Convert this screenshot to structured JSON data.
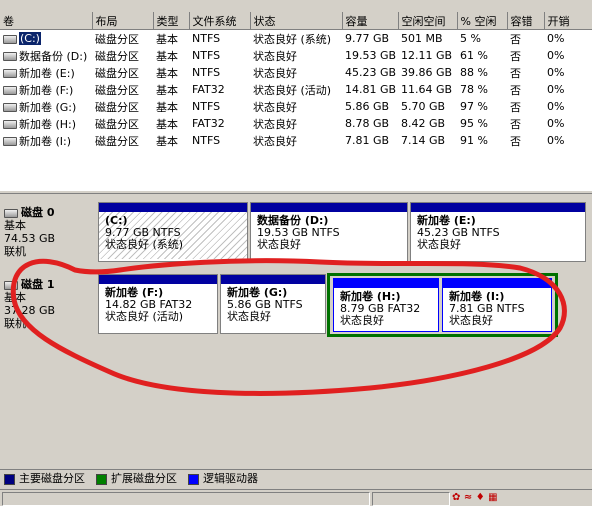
{
  "table": {
    "columns": [
      "卷",
      "布局",
      "类型",
      "文件系统",
      "状态",
      "容量",
      "空闲空间",
      "% 空闲",
      "容错",
      "开销"
    ],
    "rows": [
      {
        "vol": "(C:)",
        "layout": "磁盘分区",
        "type": "基本",
        "fs": "NTFS",
        "status": "状态良好 (系统)",
        "capacity": "9.77 GB",
        "free": "501 MB",
        "pct": "5 %",
        "fault": "否",
        "overhead": "0%"
      },
      {
        "vol": "数据备份 (D:)",
        "layout": "磁盘分区",
        "type": "基本",
        "fs": "NTFS",
        "status": "状态良好",
        "capacity": "19.53 GB",
        "free": "12.11 GB",
        "pct": "61 %",
        "fault": "否",
        "overhead": "0%"
      },
      {
        "vol": "新加卷 (E:)",
        "layout": "磁盘分区",
        "type": "基本",
        "fs": "NTFS",
        "status": "状态良好",
        "capacity": "45.23 GB",
        "free": "39.86 GB",
        "pct": "88 %",
        "fault": "否",
        "overhead": "0%"
      },
      {
        "vol": "新加卷 (F:)",
        "layout": "磁盘分区",
        "type": "基本",
        "fs": "FAT32",
        "status": "状态良好 (活动)",
        "capacity": "14.81 GB",
        "free": "11.64 GB",
        "pct": "78 %",
        "fault": "否",
        "overhead": "0%"
      },
      {
        "vol": "新加卷 (G:)",
        "layout": "磁盘分区",
        "type": "基本",
        "fs": "NTFS",
        "status": "状态良好",
        "capacity": "5.86 GB",
        "free": "5.70 GB",
        "pct": "97 %",
        "fault": "否",
        "overhead": "0%"
      },
      {
        "vol": "新加卷 (H:)",
        "layout": "磁盘分区",
        "type": "基本",
        "fs": "FAT32",
        "status": "状态良好",
        "capacity": "8.78 GB",
        "free": "8.42 GB",
        "pct": "95 %",
        "fault": "否",
        "overhead": "0%"
      },
      {
        "vol": "新加卷 (I:)",
        "layout": "磁盘分区",
        "type": "基本",
        "fs": "NTFS",
        "status": "状态良好",
        "capacity": "7.81 GB",
        "free": "7.14 GB",
        "pct": "91 %",
        "fault": "否",
        "overhead": "0%"
      }
    ]
  },
  "disks": [
    {
      "name": "磁盘 0",
      "type": "基本",
      "size": "74.53 GB",
      "state": "联机",
      "partitions": [
        {
          "name": "(C:)",
          "info": "9.77 GB NTFS",
          "status": "状态良好 (系统)"
        },
        {
          "name": "数据备份  (D:)",
          "info": "19.53 GB NTFS",
          "status": "状态良好"
        },
        {
          "name": "新加卷  (E:)",
          "info": "45.23 GB NTFS",
          "status": "状态良好"
        }
      ]
    },
    {
      "name": "磁盘 1",
      "type": "基本",
      "size": "37.28 GB",
      "state": "联机",
      "partitions": [
        {
          "name": "新加卷  (F:)",
          "info": "14.82 GB FAT32",
          "status": "状态良好 (活动)"
        },
        {
          "name": "新加卷  (G:)",
          "info": "5.86 GB NTFS",
          "status": "状态良好"
        },
        {
          "name": "新加卷  (H:)",
          "info": "8.79 GB FAT32",
          "status": "状态良好"
        },
        {
          "name": "新加卷  (I:)",
          "info": "7.81 GB NTFS",
          "status": "状态良好"
        }
      ]
    }
  ],
  "legend": [
    {
      "label": "主要磁盘分区",
      "color": "#000080"
    },
    {
      "label": "扩展磁盘分区",
      "color": "#008000"
    },
    {
      "label": "逻辑驱动器",
      "color": "#0000ff"
    }
  ],
  "annotation_color": "#e02020"
}
